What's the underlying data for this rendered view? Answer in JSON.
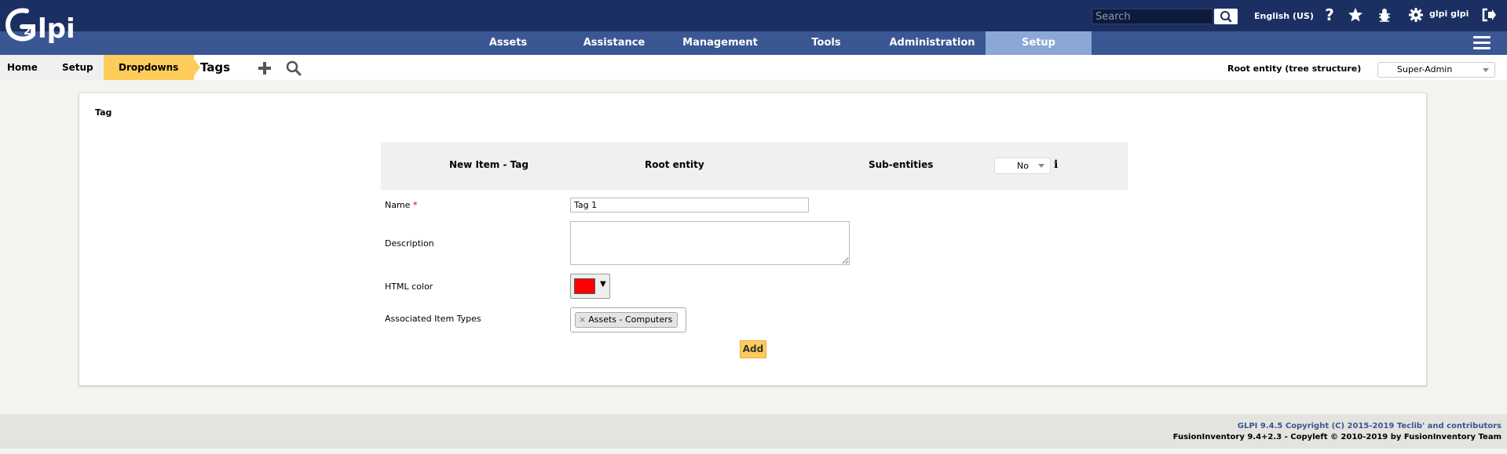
{
  "header": {
    "logo_text": "Glpi",
    "search_placeholder": "Search",
    "language": "English (US)",
    "user": "glpi glpi"
  },
  "nav": {
    "items": [
      "Assets",
      "Assistance",
      "Management",
      "Tools",
      "Administration",
      "Setup"
    ],
    "active": "Setup"
  },
  "breadcrumb": {
    "home": "Home",
    "setup": "Setup",
    "dropdowns": "Dropdowns",
    "current": "Tags"
  },
  "entity": {
    "root_label": "Root entity (tree structure)",
    "profile": "Super-Admin"
  },
  "panel": {
    "tab_title": "Tag",
    "header": {
      "new_item": "New Item - Tag",
      "entity": "Root entity",
      "sub_entities_label": "Sub-entities",
      "sub_entities_value": "No",
      "info_icon_glyph": "i"
    },
    "fields": {
      "name_label": "Name",
      "required_mark": "*",
      "name_value": "Tag 1",
      "description_label": "Description",
      "description_value": "",
      "color_label": "HTML color",
      "color_value": "#ff0000",
      "types_label": "Associated Item Types",
      "types_selected": "Assets - Computers"
    },
    "add_button": "Add"
  },
  "footer": {
    "line1": "GLPI 9.4.5 Copyright (C) 2015-2019 Teclib' and contributors",
    "line2": "FusionInventory 9.4+2.3 - Copyleft © 2010-2019 by FusionInventory Team"
  },
  "colors": {
    "topbar": "#1b2f62",
    "navbar": "#3a5693",
    "nav_active": "#8ba7d6",
    "accent": "#fecc5a"
  }
}
